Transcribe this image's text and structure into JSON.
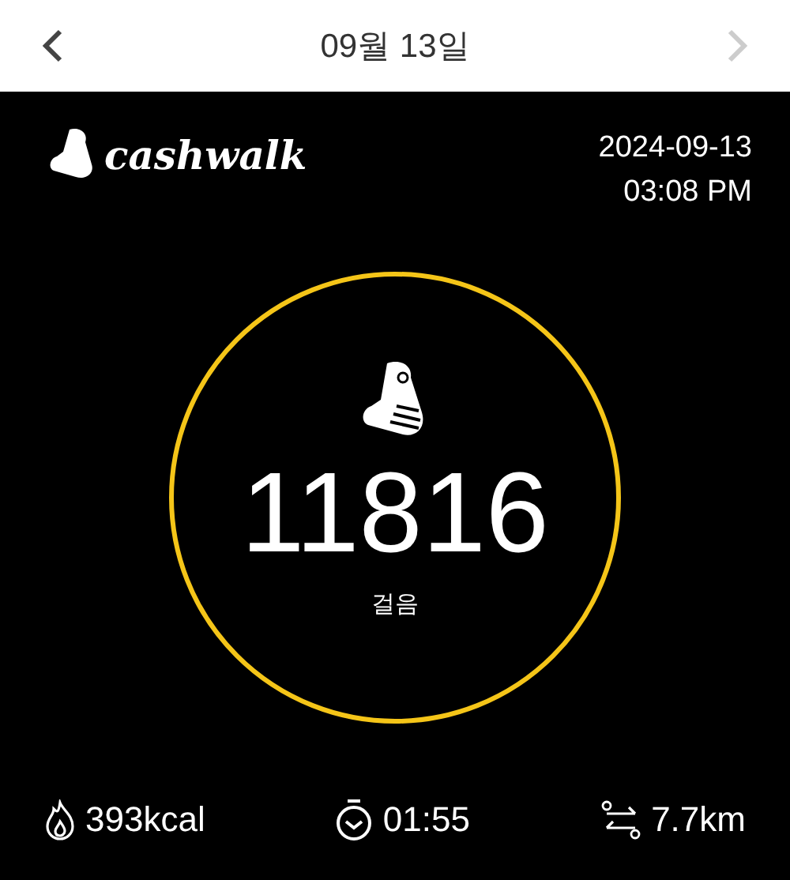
{
  "header": {
    "title": "09월 13일",
    "prev_disabled": false,
    "next_disabled": true
  },
  "brand": {
    "logo_text": "cashwalk"
  },
  "timestamp": {
    "date": "2024-09-13",
    "time": "03:08 PM"
  },
  "steps": {
    "count": "11816",
    "unit": "걸음"
  },
  "stats": [
    {
      "kind": "calories",
      "value": "393kcal"
    },
    {
      "kind": "duration",
      "value": "01:55"
    },
    {
      "kind": "distance",
      "value": "7.7km"
    }
  ]
}
